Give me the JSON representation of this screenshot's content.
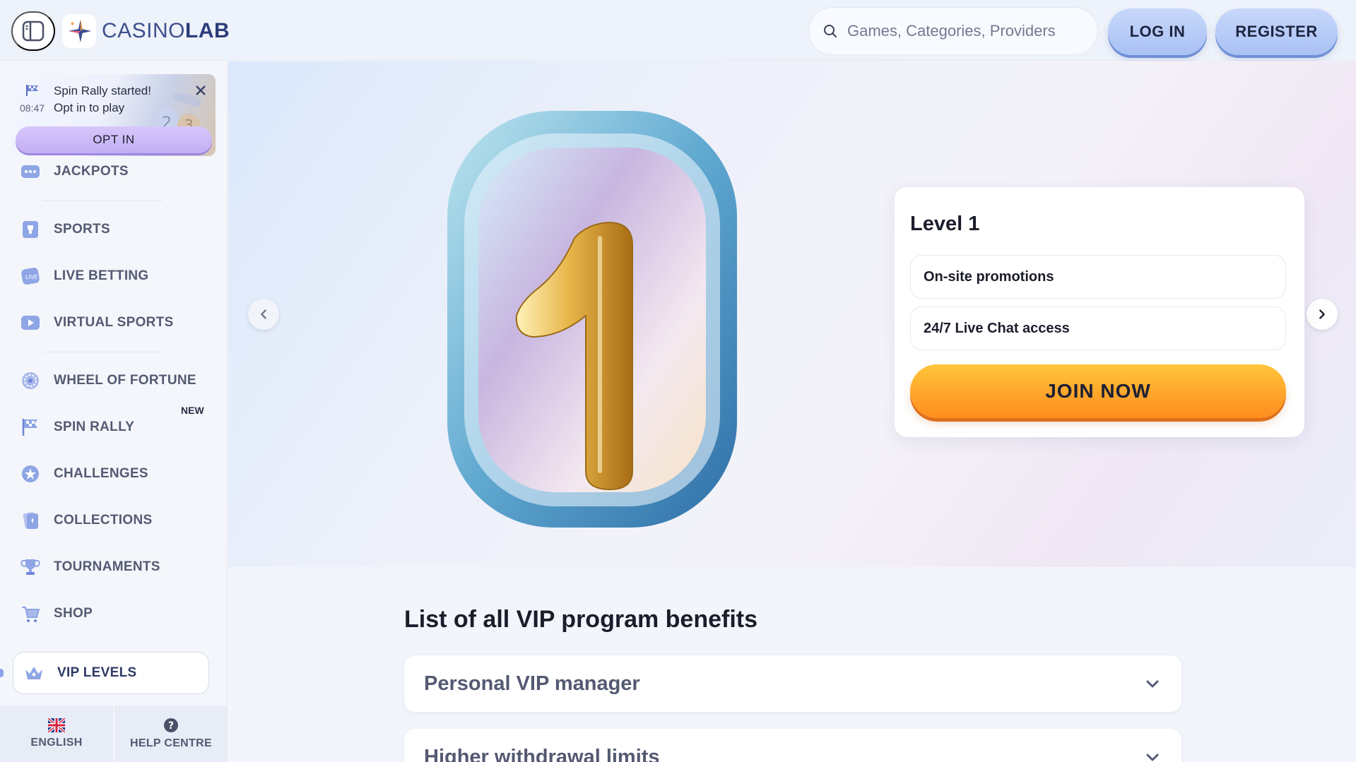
{
  "header": {
    "logo_text_a": "CASINO",
    "logo_text_b": "LAB",
    "search_placeholder": "Games, Categories, Providers",
    "login_label": "LOG IN",
    "register_label": "REGISTER"
  },
  "toast": {
    "time": "08:47",
    "title": "Spin Rally started!",
    "subtitle": "Opt in to play",
    "button_label": "OPT IN"
  },
  "sidebar": {
    "items": [
      {
        "label": "JACKPOTS",
        "icon": "jackpot-icon"
      },
      {
        "label": "SPORTS",
        "icon": "sports-icon"
      },
      {
        "label": "LIVE BETTING",
        "icon": "live-betting-icon"
      },
      {
        "label": "VIRTUAL SPORTS",
        "icon": "virtual-sports-icon"
      },
      {
        "label": "WHEEL OF FORTUNE",
        "icon": "wheel-icon"
      },
      {
        "label": "SPIN RALLY",
        "icon": "flag-icon"
      },
      {
        "label": "CHALLENGES",
        "icon": "star-badge-icon"
      },
      {
        "label": "COLLECTIONS",
        "icon": "cards-icon"
      },
      {
        "label": "TOURNAMENTS",
        "icon": "trophy-icon"
      },
      {
        "label": "SHOP",
        "icon": "cart-icon"
      }
    ],
    "new_badge": "NEW",
    "vip_label": "VIP LEVELS",
    "footer": {
      "language": "ENGLISH",
      "help": "HELP CENTRE"
    }
  },
  "hero": {
    "level_title": "Level 1",
    "perks": [
      "On-site promotions",
      "24/7 Live Chat access"
    ],
    "join_label": "JOIN NOW",
    "numeral": "1"
  },
  "benefits": {
    "title": "List of all VIP program benefits",
    "items": [
      "Personal VIP manager",
      "Higher withdrawal limits"
    ]
  },
  "colors": {
    "accent_blue": "#a9c1f4",
    "join_orange": "#ffa32a",
    "opt_in_purple": "#c2aef3"
  }
}
